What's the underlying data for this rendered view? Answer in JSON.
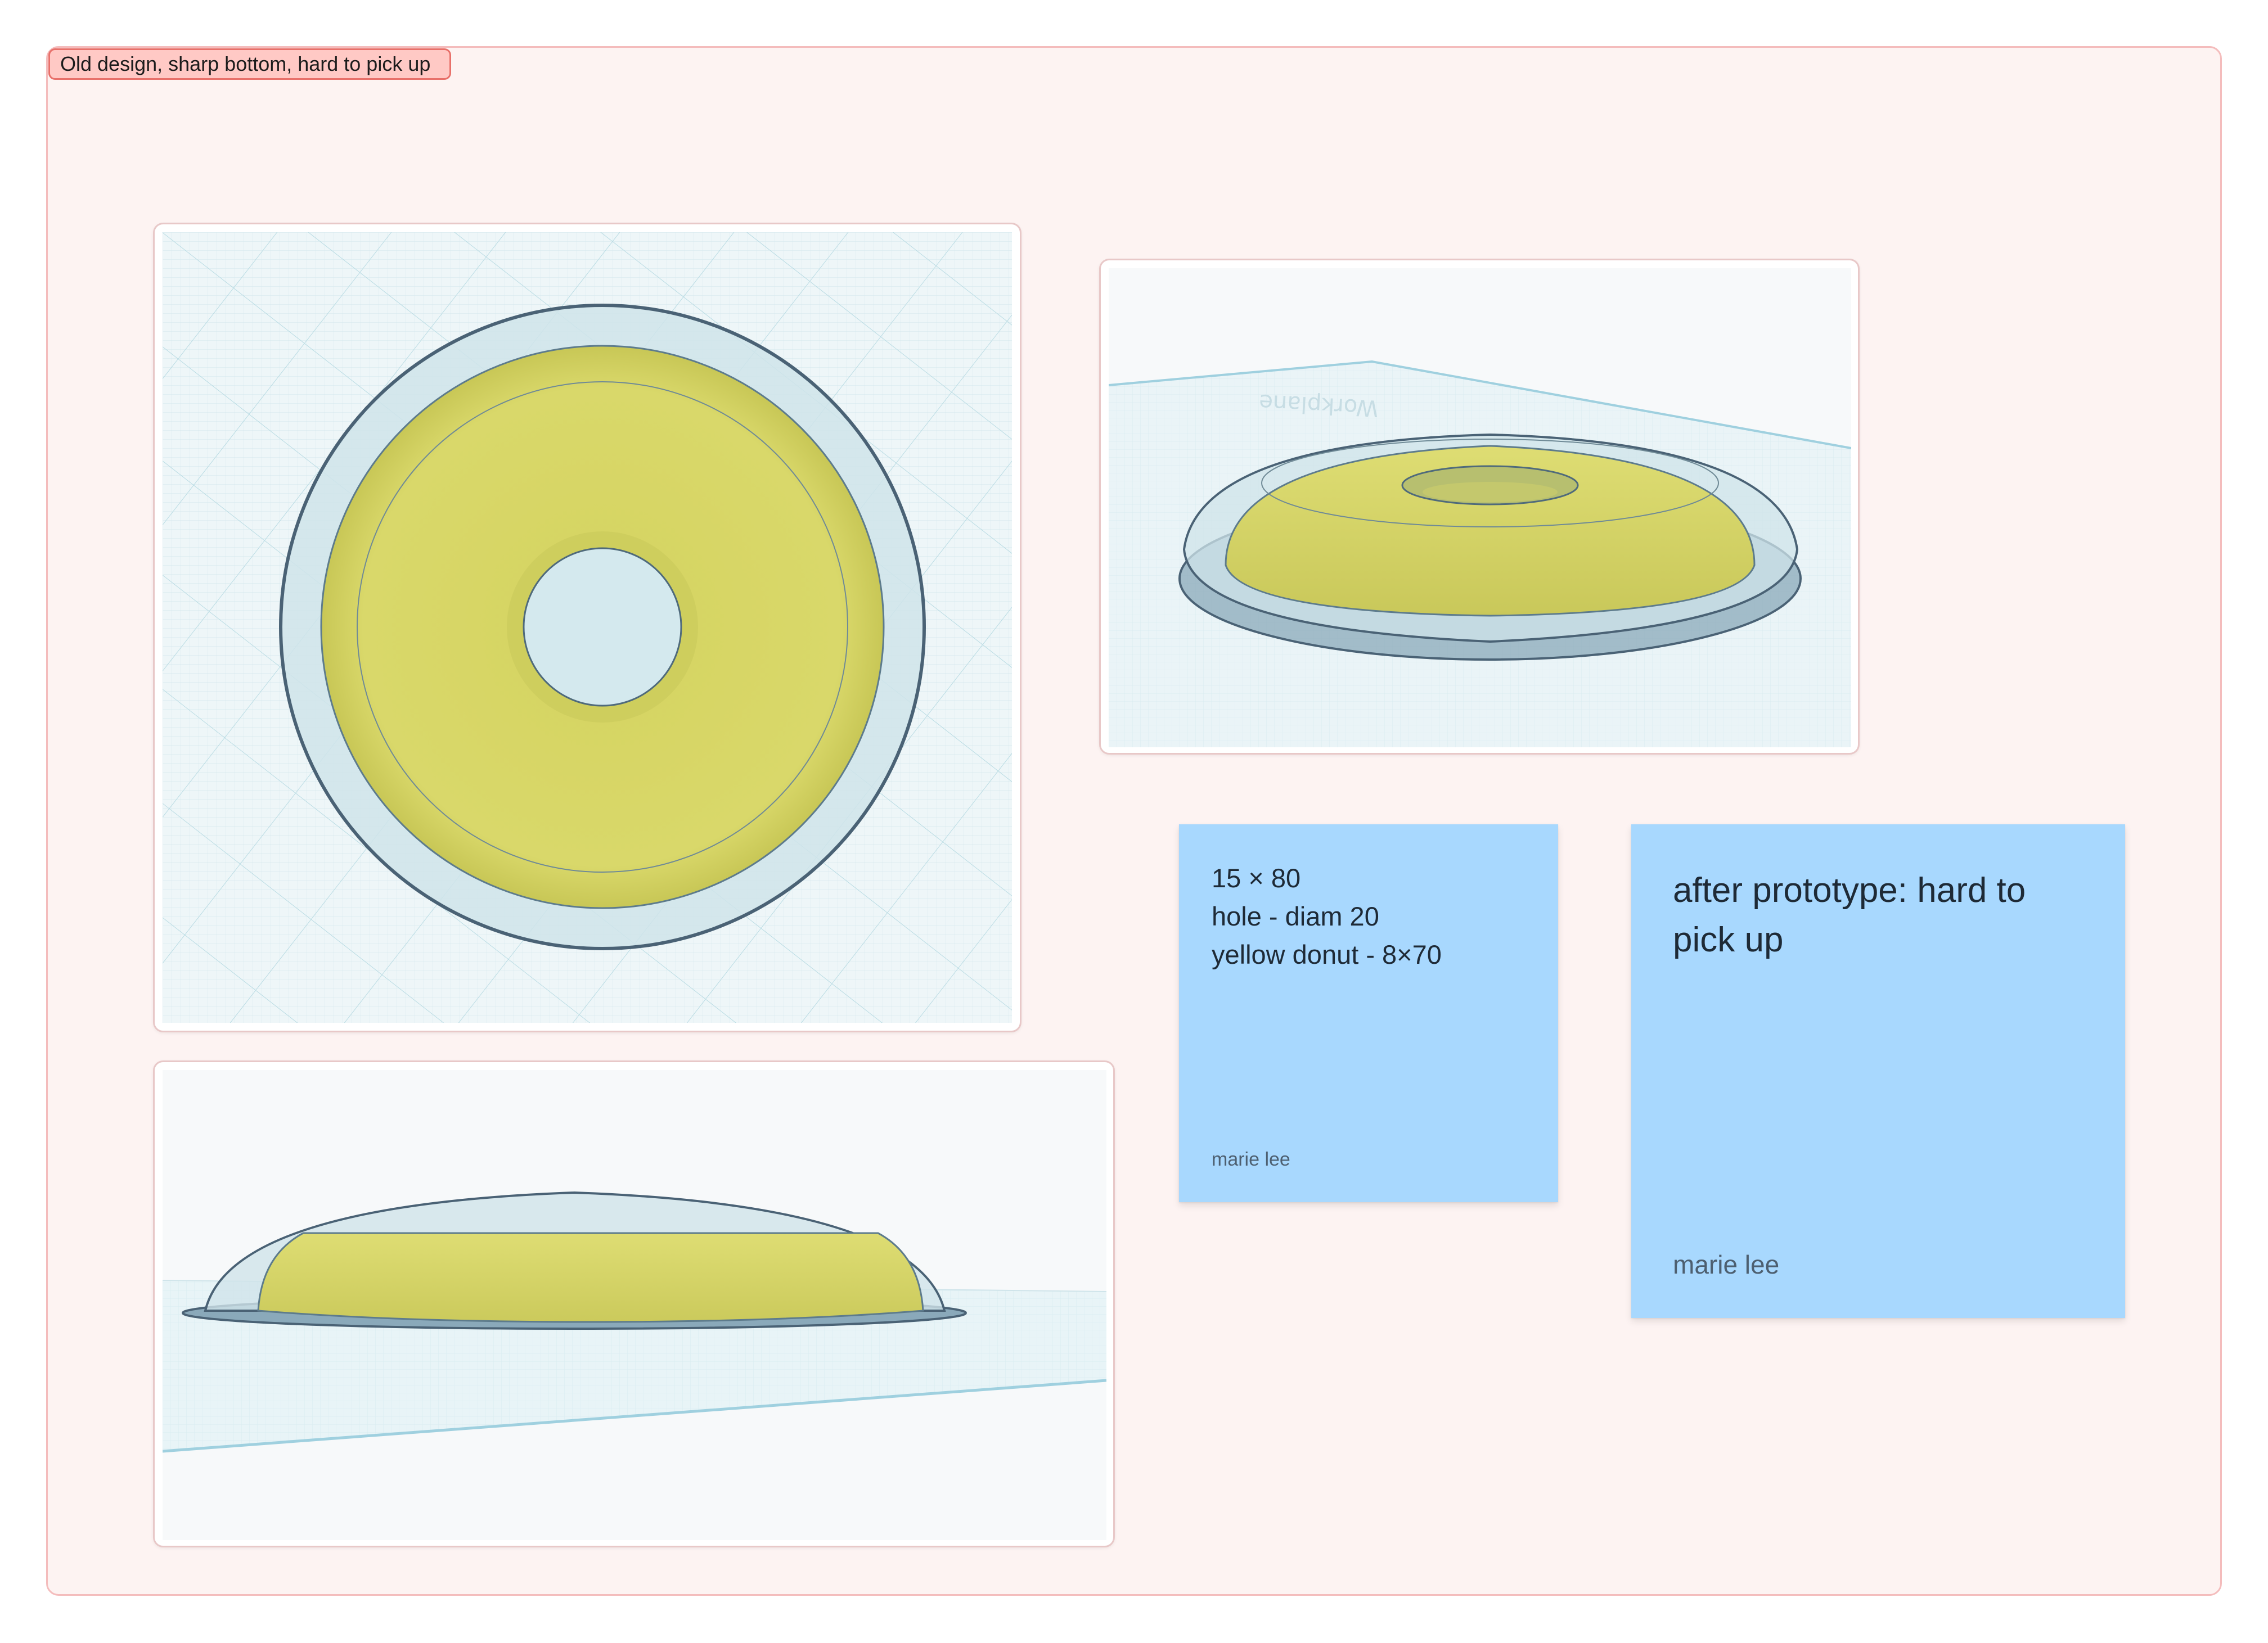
{
  "board": {
    "section_label": "Old design, sharp bottom, hard to pick up"
  },
  "images": [
    {
      "view": "top view",
      "colors": {
        "shell": "#cfe4ea",
        "donut": "#d8d75e",
        "grid": "#e6f2f5"
      }
    },
    {
      "view": "perspective view",
      "workplane_text": "Workplane"
    },
    {
      "view": "side view"
    }
  ],
  "notes": [
    {
      "lines": [
        "15 × 80",
        "hole - diam 20",
        "yellow donut - 8×70"
      ],
      "author": "marie lee",
      "color": "#a8d8fe"
    },
    {
      "text": "after prototype: hard to pick up",
      "author": "marie lee",
      "color": "#a8d8fe"
    }
  ]
}
